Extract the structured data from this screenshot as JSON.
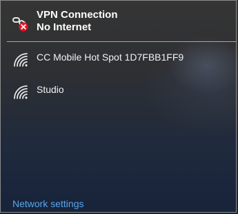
{
  "vpn": {
    "name": "VPN Connection",
    "status": "No Internet",
    "icon": "vpn-disconnected-icon"
  },
  "networks": [
    {
      "name": "CC Mobile Hot Spot 1D7FBB1FF9",
      "icon": "wifi-icon"
    },
    {
      "name": "Studio",
      "icon": "wifi-icon"
    }
  ],
  "footer": {
    "settings_link": "Network settings"
  },
  "colors": {
    "link": "#58a6ee",
    "error_badge": "#e81123",
    "text": "#ffffff"
  }
}
